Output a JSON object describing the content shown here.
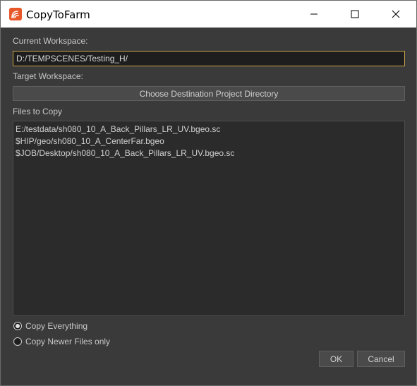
{
  "window": {
    "title": "CopyToFarm",
    "icon": "houdini-logo-icon",
    "controls": [
      "minimize-icon",
      "maximize-icon",
      "close-icon"
    ]
  },
  "current_workspace": {
    "label": "Current Workspace:",
    "value": "D:/TEMPSCENES/Testing_H/"
  },
  "target_workspace": {
    "label": "Target Workspace:",
    "button_label": "Choose Destination Project Directory"
  },
  "files": {
    "label": "Files to Copy",
    "items": [
      "E:/testdata/sh080_10_A_Back_Pillars_LR_UV.bgeo.sc",
      "$HIP/geo/sh080_10_A_CenterFar.bgeo",
      "$JOB/Desktop/sh080_10_A_Back_Pillars_LR_UV.bgeo.sc"
    ]
  },
  "options": {
    "copy_everything": "Copy Everything",
    "copy_newer": "Copy Newer Files only",
    "selected": "copy_everything"
  },
  "buttons": {
    "ok": "OK",
    "cancel": "Cancel"
  },
  "colors": {
    "background": "#3a3a3a",
    "input_border_focus": "#c9a24a",
    "list_background": "#2b2b2b",
    "icon_orange": "#e8572a"
  }
}
